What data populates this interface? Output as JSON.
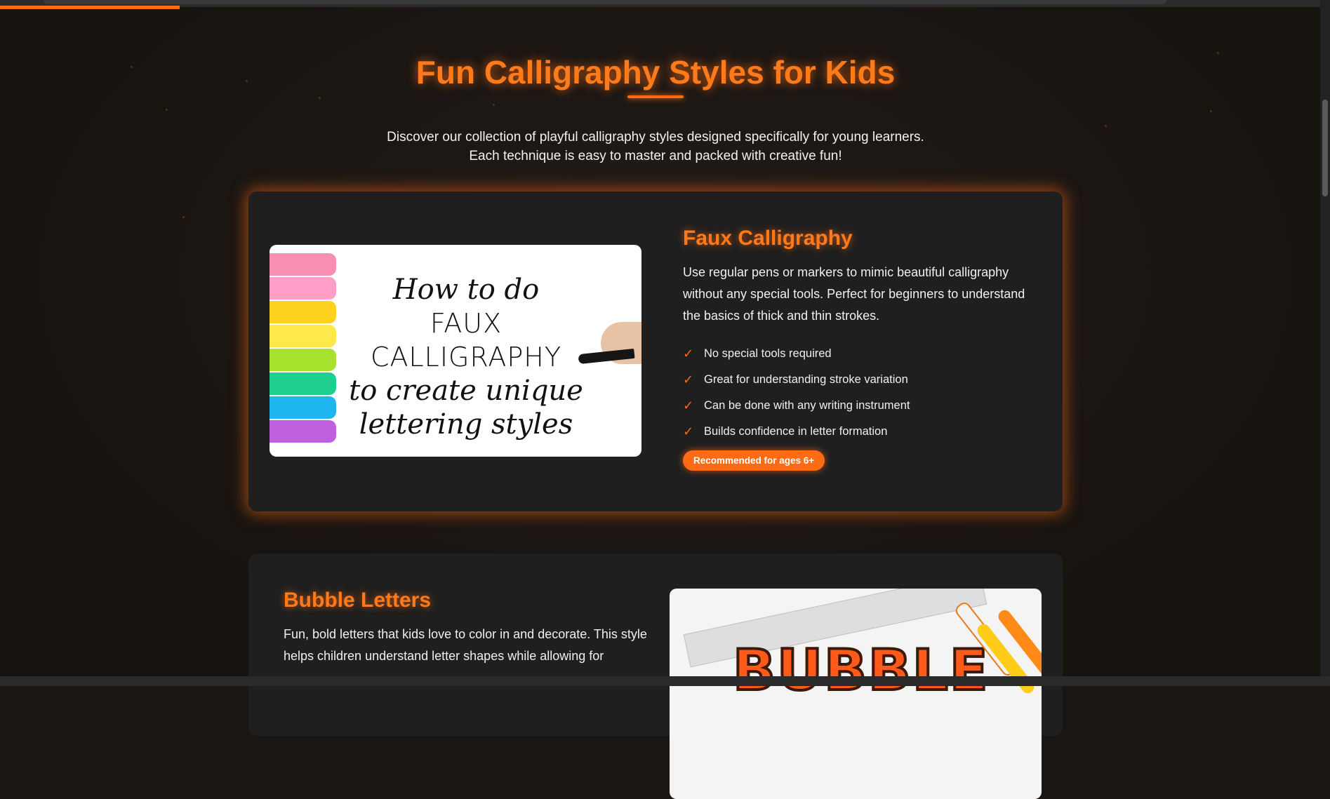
{
  "section": {
    "title": "Fun Calligraphy Styles for Kids",
    "intro_line1": "Discover our collection of playful calligraphy styles designed specifically for young learners.",
    "intro_line2": "Each technique is easy to master and packed with creative fun!"
  },
  "styles": [
    {
      "name": "Faux Calligraphy",
      "description": "Use regular pens or markers to mimic beautiful calligraphy without any special tools. Perfect for beginners to understand the basics of thick and thin strokes.",
      "features": [
        "No special tools required",
        "Great for understanding stroke variation",
        "Can be done with any writing instrument",
        "Builds confidence in letter formation"
      ],
      "badge": "Recommended for ages 6+",
      "image_text": {
        "line1": "How to do",
        "line2": "FAUX CALLIGRAPHY",
        "line3": "to create unique",
        "line4": "lettering styles"
      }
    },
    {
      "name": "Bubble Letters",
      "description": "Fun, bold letters that kids love to color in and decorate. This style helps children understand letter shapes while allowing for",
      "image_text": "BUBBLE"
    }
  ],
  "icons": {
    "check": "✓"
  },
  "colors": {
    "accent": "#ff6a14",
    "background": "#1a1614",
    "card": "#1f1f1f"
  }
}
